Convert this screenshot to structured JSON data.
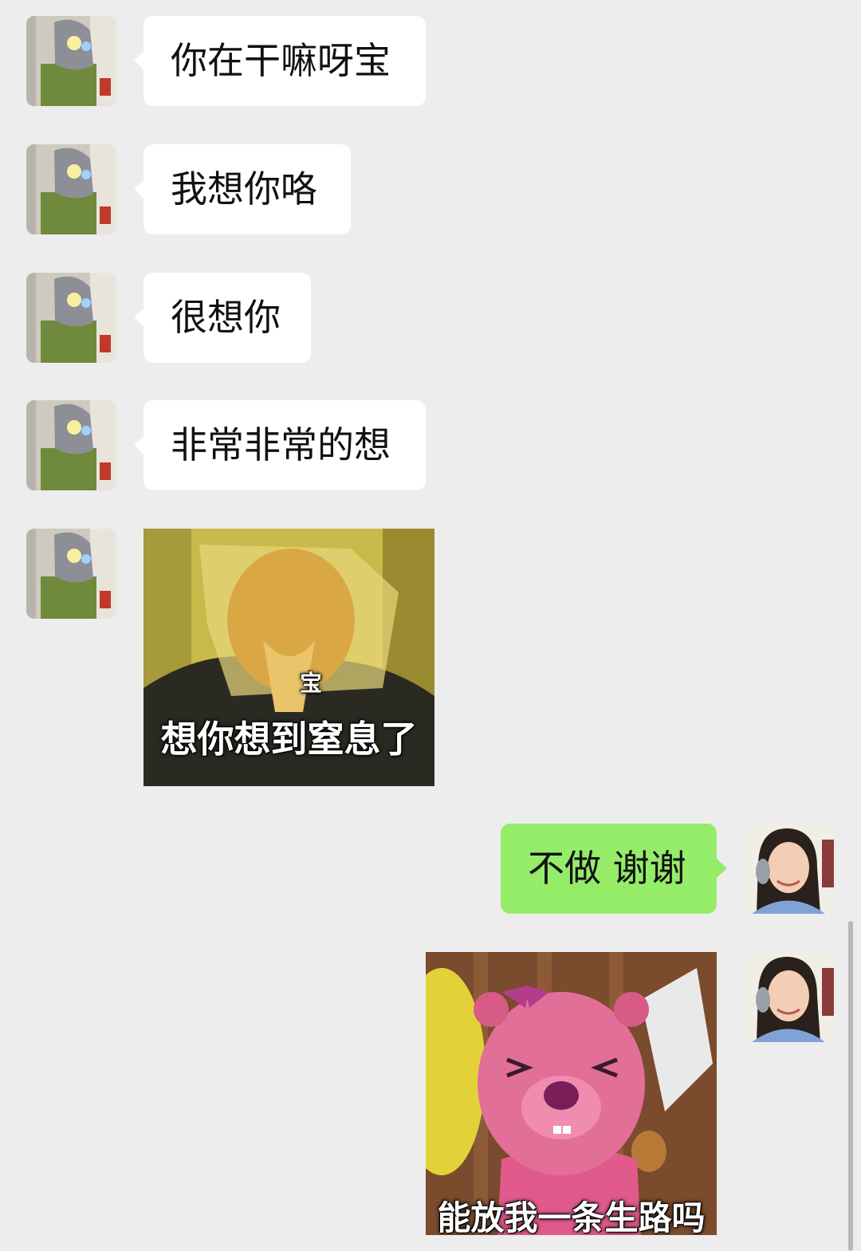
{
  "messages": [
    {
      "side": "received",
      "type": "text",
      "text": "你在干嘛呀宝"
    },
    {
      "side": "received",
      "type": "text",
      "text": "我想你咯"
    },
    {
      "side": "received",
      "type": "text",
      "text": "很想你"
    },
    {
      "side": "received",
      "type": "text",
      "text": "非常非常的想"
    },
    {
      "side": "received",
      "type": "sticker",
      "caption_small": "宝",
      "caption": "想你想到窒息了"
    },
    {
      "side": "sent",
      "type": "text",
      "text": "不做 谢谢"
    },
    {
      "side": "sent",
      "type": "sticker",
      "caption": "能放我一条生路吗"
    }
  ],
  "colors": {
    "background": "#ededed",
    "received_bubble": "#ffffff",
    "sent_bubble": "#95ec69"
  },
  "icons": {
    "contact_avatar": "masked-hero-avatar",
    "own_avatar": "girl-with-headphones-avatar"
  }
}
